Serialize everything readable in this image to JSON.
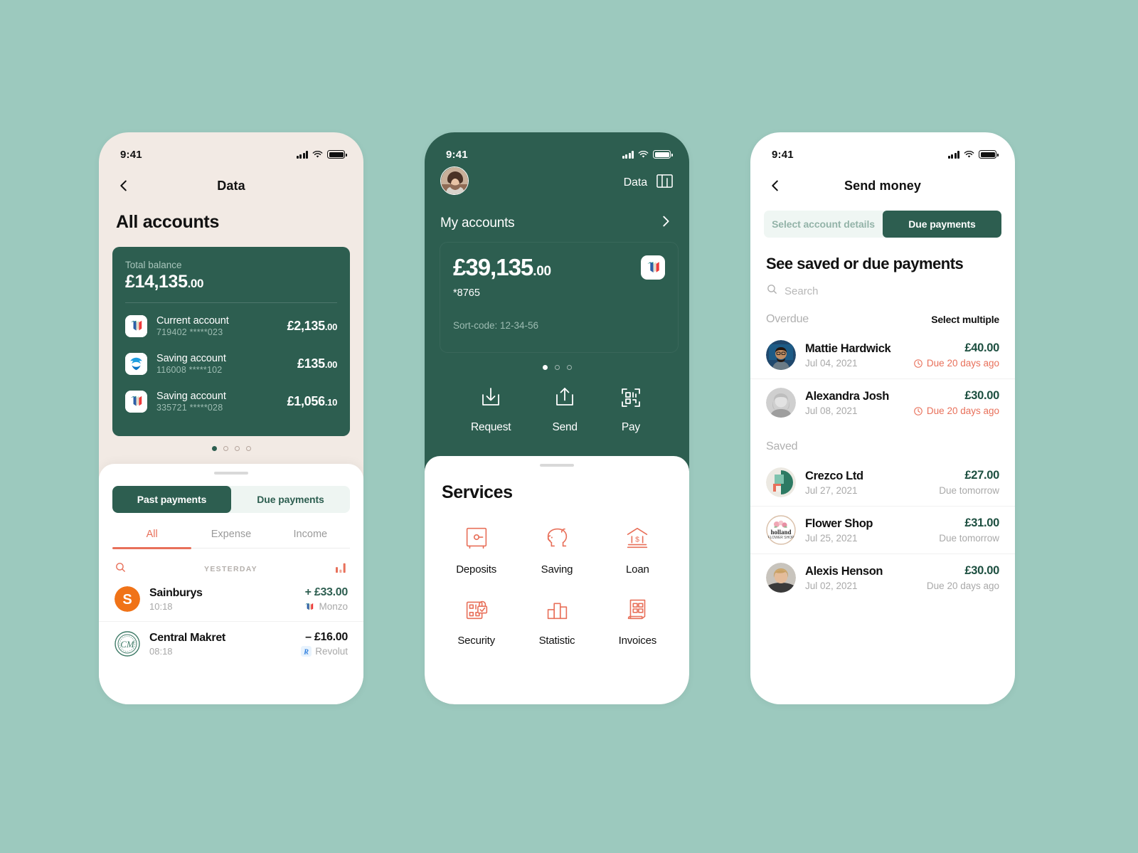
{
  "theme": {
    "page_bg": "#9cc9be",
    "dark_green": "#2d5e50",
    "cream": "#f2eae4",
    "coral": "#e8705a",
    "muted_green_text": "#9dbcb2"
  },
  "phone1": {
    "status": {
      "time": "9:41"
    },
    "nav": {
      "title": "Data",
      "back_icon": "chevron-left-icon"
    },
    "heading": "All accounts",
    "balance_card": {
      "label": "Total balance",
      "amount_main": "£14,135",
      "amount_dec": ".00",
      "accounts": [
        {
          "name": "Current account",
          "number": "719402  *****023",
          "amount_main": "£2,135",
          "amount_dec": ".00",
          "logo": "monzo-logo-icon"
        },
        {
          "name": "Saving account",
          "number": "116008  *****102",
          "amount_main": "£135",
          "amount_dec": ".00",
          "logo": "barclays-logo-icon"
        },
        {
          "name": "Saving account",
          "number": "335721  *****028",
          "amount_main": "£1,056",
          "amount_dec": ".10",
          "logo": "monzo-logo-icon"
        }
      ]
    },
    "pager": {
      "count": 4,
      "active": 0
    },
    "segment": {
      "active": "Past payments",
      "items": [
        "Past payments",
        "Due payments"
      ]
    },
    "filter_tabs": {
      "active": "All",
      "items": [
        "All",
        "Expense",
        "Income"
      ]
    },
    "list_header": {
      "search_icon": "search-icon",
      "date_label": "YESTERDAY",
      "chart_icon": "bar-chart-icon"
    },
    "transactions": [
      {
        "name": "Sainburys",
        "time": "10:18",
        "amount": "+ £33.00",
        "sign": "pos",
        "bank": "Monzo",
        "bank_icon": "monzo-logo-icon",
        "avatar": "sainsburys-logo-icon"
      },
      {
        "name": "Central Makret",
        "time": "08:18",
        "amount": "– £16.00",
        "sign": "neg",
        "bank": "Revolut",
        "bank_icon": "revolut-logo-icon",
        "avatar": "central-market-logo-icon"
      }
    ]
  },
  "phone2": {
    "status": {
      "time": "9:41"
    },
    "header": {
      "avatar": "user-avatar",
      "data_label": "Data",
      "data_icon": "bar-chart-box-icon"
    },
    "my_accounts": {
      "title": "My accounts",
      "chevron": "chevron-right-icon"
    },
    "card": {
      "amount_main": "£39,135",
      "amount_dec": ".00",
      "mask": "*8765",
      "sort_code": "Sort-code: 12-34-56",
      "logo": "monzo-logo-icon"
    },
    "pager": {
      "count": 3,
      "active": 0
    },
    "actions": [
      {
        "label": "Request",
        "icon": "download-box-icon"
      },
      {
        "label": "Send",
        "icon": "upload-box-icon"
      },
      {
        "label": "Pay",
        "icon": "qr-scan-icon"
      }
    ],
    "services": {
      "title": "Services",
      "items": [
        {
          "label": "Deposits",
          "icon": "safe-box-icon"
        },
        {
          "label": "Saving",
          "icon": "piggy-bank-icon"
        },
        {
          "label": "Loan",
          "icon": "bank-building-icon"
        },
        {
          "label": "Security",
          "icon": "lock-shield-icon"
        },
        {
          "label": "Statistic",
          "icon": "bar-chart-icon"
        },
        {
          "label": "Invoices",
          "icon": "invoice-icon"
        }
      ]
    }
  },
  "phone3": {
    "status": {
      "time": "9:41"
    },
    "nav": {
      "title": "Send money",
      "back_icon": "chevron-left-icon"
    },
    "segment": {
      "items": [
        "Select account details",
        "Due payments"
      ],
      "active": "Due payments"
    },
    "heading": "See saved or due payments",
    "search": {
      "placeholder": "Search",
      "icon": "search-icon"
    },
    "sections": [
      {
        "label": "Overdue",
        "action": "Select multiple",
        "rows": [
          {
            "name": "Mattie Hardwick",
            "date": "Jul 04, 2021",
            "amount": "£40.00",
            "due": "Due 20 days ago",
            "due_state": "late",
            "clock_icon": "clock-icon",
            "avatar": "avatar-mattie"
          },
          {
            "name": "Alexandra Josh",
            "date": "Jul 08, 2021",
            "amount": "£30.00",
            "due": "Due 20 days ago",
            "due_state": "late",
            "clock_icon": "clock-icon",
            "avatar": "avatar-alexandra"
          }
        ]
      },
      {
        "label": "Saved",
        "action": "",
        "rows": [
          {
            "name": "Crezco Ltd",
            "date": "Jul 27, 2021",
            "amount": "£27.00",
            "due": "Due tomorrow",
            "due_state": "soon",
            "clock_icon": "",
            "avatar": "crezco-logo-icon"
          },
          {
            "name": "Flower Shop",
            "date": "Jul 25, 2021",
            "amount": "£31.00",
            "due": "Due tomorrow",
            "due_state": "soon",
            "clock_icon": "",
            "avatar": "holland-flower-shop-logo-icon"
          },
          {
            "name": "Alexis Henson",
            "date": "Jul 02, 2021",
            "amount": "£30.00",
            "due": "Due 20 days ago",
            "due_state": "soon",
            "clock_icon": "",
            "avatar": "avatar-alexis"
          }
        ]
      }
    ]
  }
}
